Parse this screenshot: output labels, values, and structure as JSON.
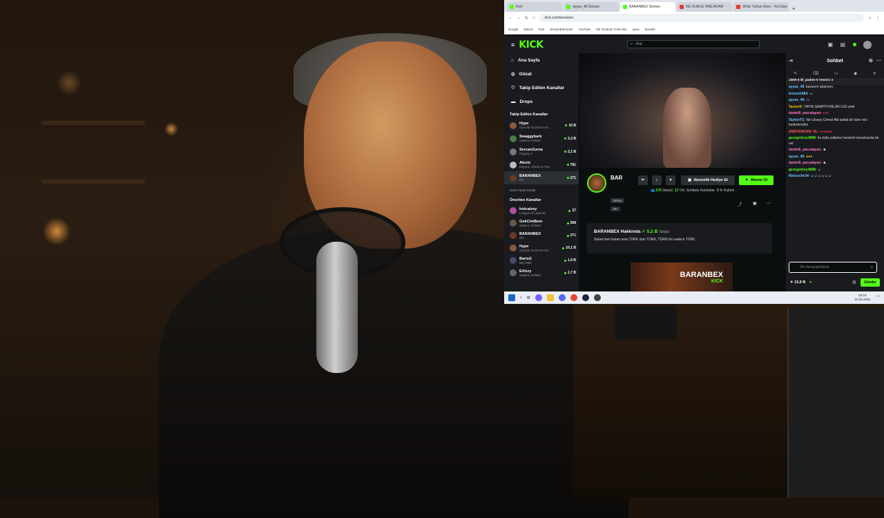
{
  "browser": {
    "tabs": [
      {
        "label": "Kick"
      },
      {
        "label": "ayyas_48 Stream"
      },
      {
        "label": "BARANBEX Stream"
      },
      {
        "label": "NE OLMUŞ YANİ ADAM"
      },
      {
        "label": "90'lar Türkçe Slow - YouTube"
      }
    ],
    "url": "kick.com/baranbex",
    "bookmarks": [
      "Google",
      "Eterna",
      "Kick",
      "StreamElements",
      "YouTube",
      "NE OLMUŞ YANİ ADL",
      "ayna",
      "baraabi"
    ]
  },
  "kick": {
    "search_placeholder": "Ara",
    "nav": [
      {
        "label": "Ana Sayfa"
      },
      {
        "label": "Gözat"
      },
      {
        "label": "Takip Edilen Kanallar"
      },
      {
        "label": "Drops"
      }
    ],
    "followed_title": "Takip Edilen Kanallar",
    "followed": [
      {
        "name": "Hype",
        "category": "Oyunlar ve Deme Sü...",
        "viewers": "10 B"
      },
      {
        "name": "Swaggybark",
        "category": "Sadece Sohbet",
        "viewers": "3,3 B"
      },
      {
        "name": "SercanZurna",
        "category": "Payday 3",
        "viewers": "2,1 B"
      },
      {
        "name": "Alexis",
        "category": "Hayvuz, Kâvet ve Piaj",
        "viewers": "781"
      },
      {
        "name": "BARANBEX",
        "category": "IRL",
        "viewers": "271"
      }
    ],
    "show_more": "Daha Fazla Göster",
    "recommended_title": "Önerilen Kanallar",
    "recommended": [
      {
        "name": "hotcatzey",
        "category": "League of Legends",
        "viewers": "27"
      },
      {
        "name": "GokCimBom",
        "category": "Sadece Sohbet",
        "viewers": "368"
      },
      {
        "name": "BARANBEX",
        "category": "IRL",
        "viewers": "271"
      },
      {
        "name": "Hype",
        "category": "Oyunlar ve Deme Sü...",
        "viewers": "10,1 B"
      },
      {
        "name": "BarisG",
        "category": "Big Walk",
        "viewers": "1,6 B"
      },
      {
        "name": "Erlizzy",
        "category": "Sadece Sohbet",
        "viewers": "2,7 B"
      }
    ],
    "channel": {
      "name": "BAR",
      "gift_label": "Abonelik Hediye Et",
      "subscribe_label": "Abone Ol",
      "viewers": "276",
      "viewers_label": "İzleyici",
      "avg_chat": "17",
      "avg_chat_label": "Ort. Sohbete Katılanlar",
      "katilim": "8 % Katılım",
      "tag_lang": "Türkçe",
      "tag_age": "18+"
    },
    "about": {
      "title": "BARANBEX Hakkında",
      "followers": "5,2 B",
      "followers_label": "Takipçi",
      "bio": "Selam ben baran ama TÜRK olan TÜRK, TÜRK'üm sadece TÜRK"
    },
    "banner": {
      "title": "BARANBEX",
      "sub": "KICK"
    },
    "chat": {
      "title": "Sohbet",
      "pinned": "JZER 8   ilil_padree 5   YeezCC 3",
      "messages": [
        {
          "user": "ayyas_48",
          "text": ": baranım adamsın.",
          "color": "#6ec6ff"
        },
        {
          "user": "lestoni1984",
          "text": ":",
          "color": "#6ec6ff"
        },
        {
          "user": "ayyas_48",
          "text": ":",
          "color": "#6ec6ff"
        },
        {
          "user": "TanzerK",
          "text": ": YAYIN ŞAMPİYONLAR LİGİ amk",
          "color": "#ffc400"
        },
        {
          "user": "dantelli_parcalayan",
          "text": ":",
          "color": "#ff79c6"
        },
        {
          "user": "TayfunTC",
          "text": ": Ne Ulussy Cemal Abi pattat bir tane reis kederlenelim",
          "color": "#6ec6ff"
        },
        {
          "user": "AMSTERDAM_NL",
          "text": ":",
          "color": "#ff5555"
        },
        {
          "user": "georgedroyd888",
          "text": ": bu kafa sallama hareketi muratcazda da var",
          "color": "#53fc18"
        },
        {
          "user": "dantelli_parcalayan",
          "text": ":",
          "color": "#ff79c6"
        },
        {
          "user": "ayyas_48",
          "text": ":",
          "color": "#6ec6ff"
        },
        {
          "user": "dantelli_parcalayan",
          "text": ":",
          "color": "#ff79c6"
        },
        {
          "user": "georgedroyd888",
          "text": ":",
          "color": "#53fc18"
        },
        {
          "user": "Nietzsche34",
          "text": ":",
          "color": "#6ec6ff"
        }
      ],
      "input_placeholder": "Bir mesaj gönderin",
      "points": "15,9 B",
      "send_label": "Gönder"
    }
  },
  "taskbar": {
    "time": "03:16",
    "date": "22.06.2026"
  },
  "colors": {
    "kick_green": "#53fc18",
    "panel": "#191b1f",
    "bg": "#0b0e0f"
  }
}
